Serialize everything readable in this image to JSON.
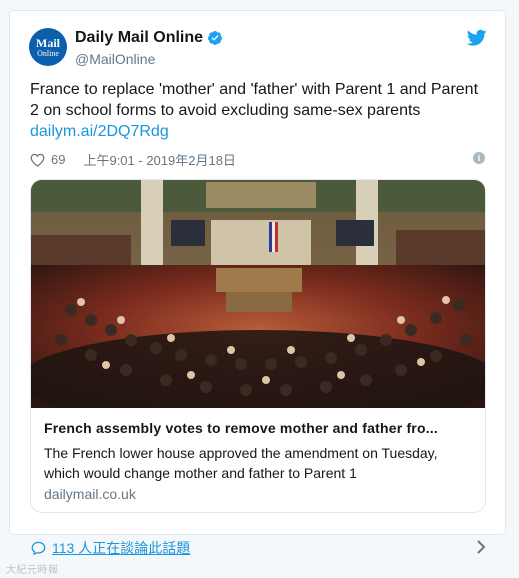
{
  "author": {
    "avatar_line1": "Mail",
    "avatar_line2": "Online",
    "name": "Daily Mail Online",
    "handle": "@MailOnline"
  },
  "tweet": {
    "text": "France to replace 'mother' and 'father' with Parent 1 and Parent 2 on school forms to avoid excluding same-sex parents",
    "link": "dailym.ai/2DQ7Rdg",
    "likes": "69",
    "timestamp": "上午9:01 - 2019年2月18日"
  },
  "link_card": {
    "title": "French assembly votes to remove mother and father fro...",
    "description": "The French lower house approved the amendment on Tuesday, which would change mother and father to Parent 1",
    "domain": "dailymail.co.uk"
  },
  "footer": {
    "conversation": "113 人正在談論此話題"
  },
  "watermark": "大紀元時報",
  "icons": {
    "verified": "verified-badge-icon",
    "twitter": "twitter-bird-icon",
    "like": "heart-icon",
    "info": "info-icon",
    "reply": "speech-bubble-icon",
    "chevron": "chevron-right-icon"
  },
  "colors": {
    "brand_blue": "#1b95e0",
    "avatar_blue": "#0c5fab",
    "text": "#14171a",
    "muted": "#657786"
  }
}
